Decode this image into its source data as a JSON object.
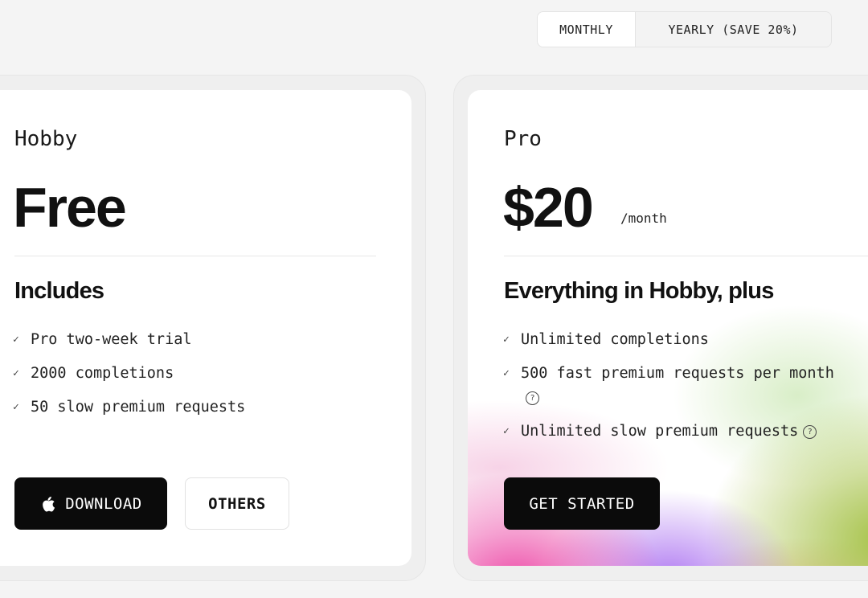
{
  "billing_toggle": {
    "monthly_label": "MONTHLY",
    "yearly_label": "YEARLY (SAVE 20%)",
    "selected": "MONTHLY"
  },
  "plans": {
    "hobby": {
      "name": "Hobby",
      "price": "Free",
      "includes_heading": "Includes",
      "features": [
        "Pro two-week trial",
        "2000 completions",
        "50 slow premium requests"
      ],
      "primary_button": {
        "label": "DOWNLOAD",
        "icon": "apple-icon"
      },
      "secondary_button": {
        "label": "OTHERS"
      }
    },
    "pro": {
      "name": "Pro",
      "price": "$20",
      "period": "/month",
      "includes_heading": "Everything in Hobby, plus",
      "features": [
        "Unlimited completions",
        "500 fast premium requests per month",
        "Unlimited slow premium requests"
      ],
      "primary_button": {
        "label": "GET STARTED"
      }
    }
  },
  "icons": {
    "check": "✓",
    "help": "?"
  },
  "colors": {
    "background": "#f4f4f4",
    "card": "#ffffff",
    "button_dark": "#0b0b0b",
    "gradient_pink": "#ec48a6",
    "gradient_purple": "#a86cf0",
    "gradient_green": "#a0be3c"
  }
}
